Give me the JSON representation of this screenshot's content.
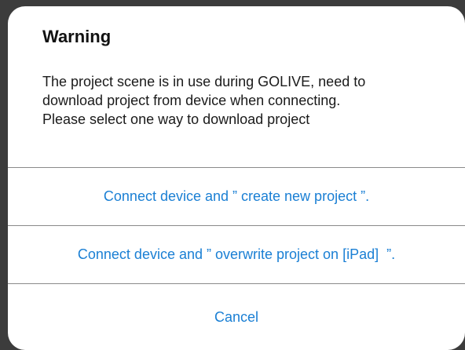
{
  "alert": {
    "title": "Warning",
    "message_lines": [
      "The project scene is in use during GOLIVE, need to",
      "download project from device when connecting.",
      "Please select one way to download project"
    ],
    "actions": [
      {
        "label": "Connect device and ” create new project ”."
      },
      {
        "label": "Connect device and ” overwrite project on [iPad]  ”."
      },
      {
        "label": "Cancel"
      }
    ],
    "colors": {
      "action_text": "#1a7fd4",
      "title_text": "#111111",
      "background": "#ffffff"
    }
  }
}
